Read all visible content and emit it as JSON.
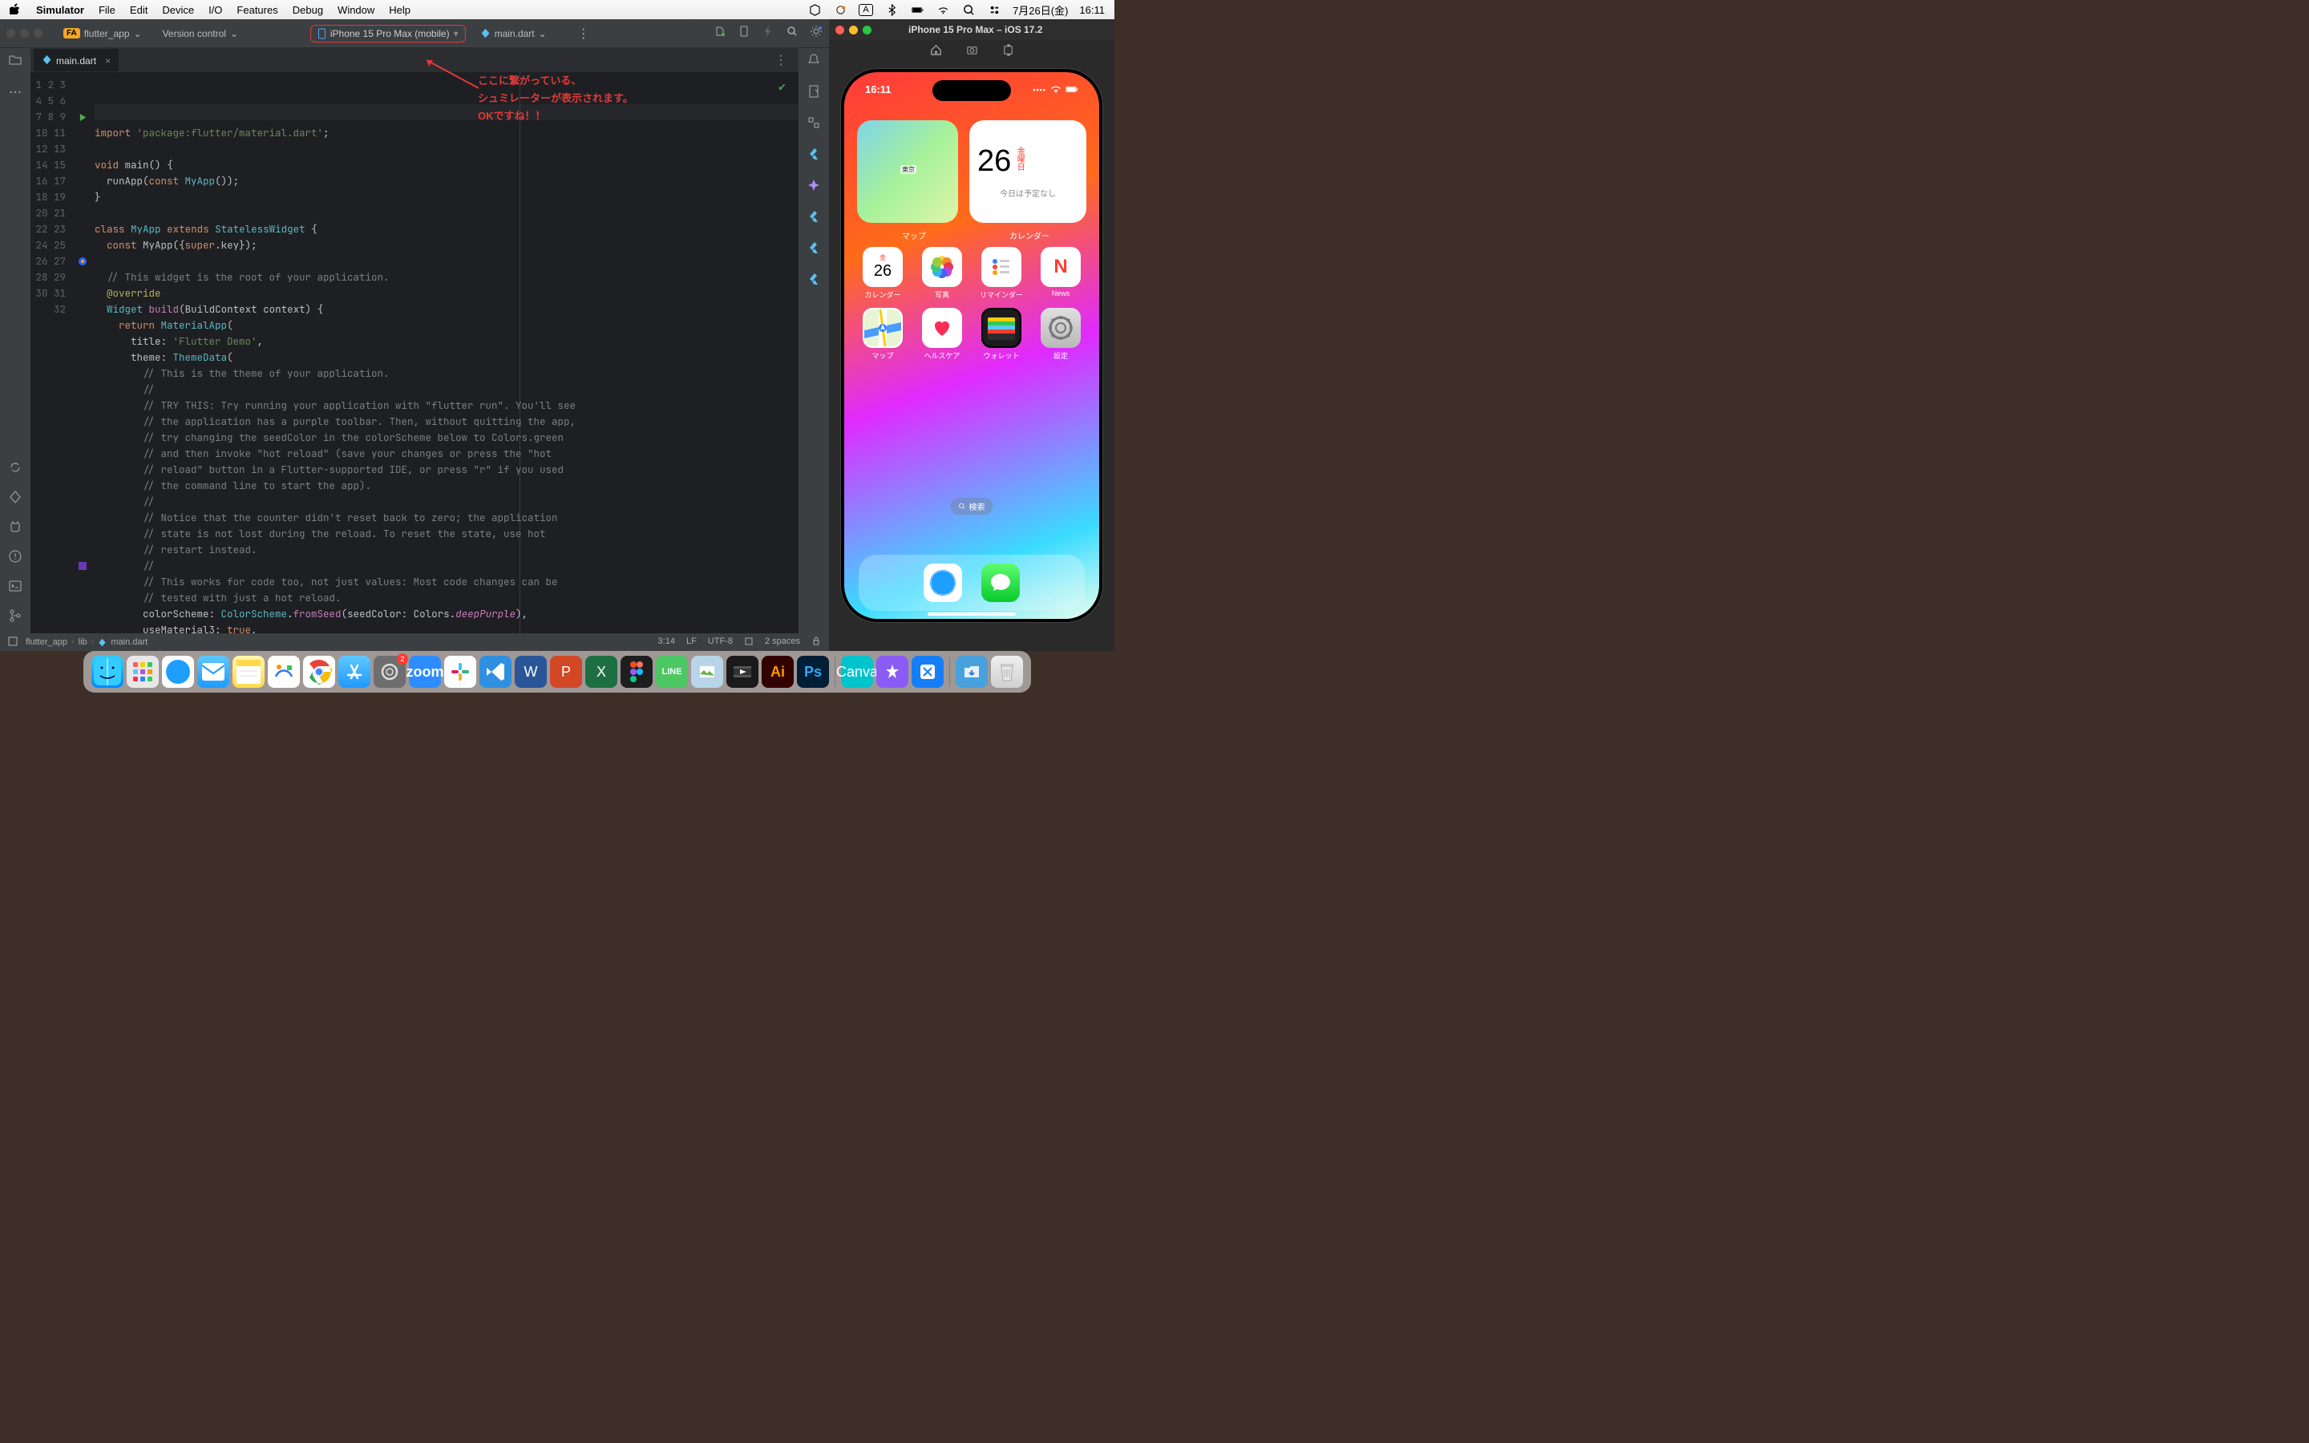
{
  "menubar": {
    "app": "Simulator",
    "items": [
      "File",
      "Edit",
      "Device",
      "I/O",
      "Features",
      "Debug",
      "Window",
      "Help"
    ],
    "date": "7月26日(金)",
    "time": "16:11",
    "lang": "A"
  },
  "ide": {
    "project": "flutter_app",
    "project_badge": "FA",
    "version_control": "Version control",
    "device": "iPhone 15 Pro Max (mobile)",
    "open_file_tab": "main.dart",
    "open_file_full": "main.dart",
    "code": {
      "lines": [
        1,
        2,
        3,
        4,
        5,
        6,
        7,
        8,
        9,
        10,
        11,
        12,
        13,
        14,
        15,
        16,
        17,
        18,
        19,
        20,
        21,
        22,
        23,
        24,
        25,
        26,
        27,
        28,
        29,
        30,
        31,
        32
      ]
    },
    "breadcrumb": [
      "flutter_app",
      "lib",
      "main.dart"
    ],
    "status": {
      "pos": "3:14",
      "eol": "LF",
      "enc": "UTF-8",
      "indent": "2 spaces"
    }
  },
  "annotation": {
    "l1": "ここに繋がっている、",
    "l2": "シュミレーターが表示されます。",
    "l3": "OKですね！！"
  },
  "simulator": {
    "title": "iPhone 15 Pro Max – iOS 17.2",
    "status_time": "16:11",
    "widgets": {
      "map_city": "東京",
      "map_label": "マップ",
      "cal_num": "26",
      "cal_day": "金曜日",
      "cal_event": "今日は予定なし",
      "cal_label": "カレンダー"
    },
    "apps": [
      {
        "id": "cal",
        "label": "カレンダー",
        "day": "金",
        "num": "26"
      },
      {
        "id": "photos",
        "label": "写真"
      },
      {
        "id": "reminders",
        "label": "リマインダー"
      },
      {
        "id": "news",
        "label": "News"
      },
      {
        "id": "maps",
        "label": "マップ"
      },
      {
        "id": "health",
        "label": "ヘルスケア"
      },
      {
        "id": "wallet",
        "label": "ウォレット"
      },
      {
        "id": "settings",
        "label": "設定"
      }
    ],
    "search": "検索"
  },
  "dock": {
    "sys_badge": "2"
  }
}
